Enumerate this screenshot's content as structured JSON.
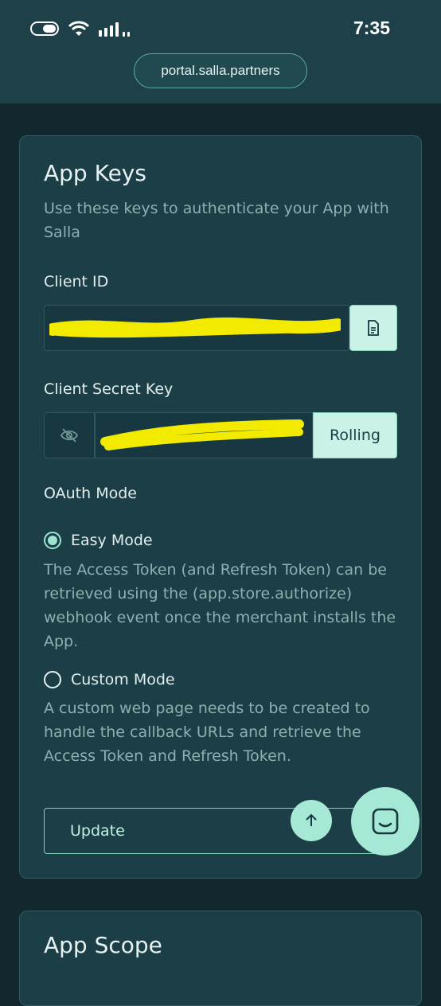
{
  "status_bar": {
    "time": "7:35"
  },
  "browser": {
    "url": "portal.salla.partners"
  },
  "app_keys": {
    "title": "App Keys",
    "description": "Use these keys to authenticate your App with Salla",
    "client_id_label": "Client ID",
    "client_id_icon": "copy-document-icon",
    "client_secret_label": "Client Secret Key",
    "client_secret_icon": "eye-off-icon",
    "rolling_label": "Rolling",
    "oauth_label": "OAuth Mode",
    "easy_mode": {
      "label": "Easy Mode",
      "selected": true,
      "description": "The Access Token (and Refresh Token) can be retrieved using the (app.store.authorize) webhook event once the merchant installs the App."
    },
    "custom_mode": {
      "label": "Custom Mode",
      "selected": false,
      "description": "A custom web page needs to be created to handle the callback URLs and retrieve the Access Token and Refresh Token."
    },
    "update_label": "Update"
  },
  "app_scope": {
    "title": "App Scope"
  },
  "colors": {
    "accent": "#a5e8d5",
    "redaction": "#f2ea00"
  }
}
